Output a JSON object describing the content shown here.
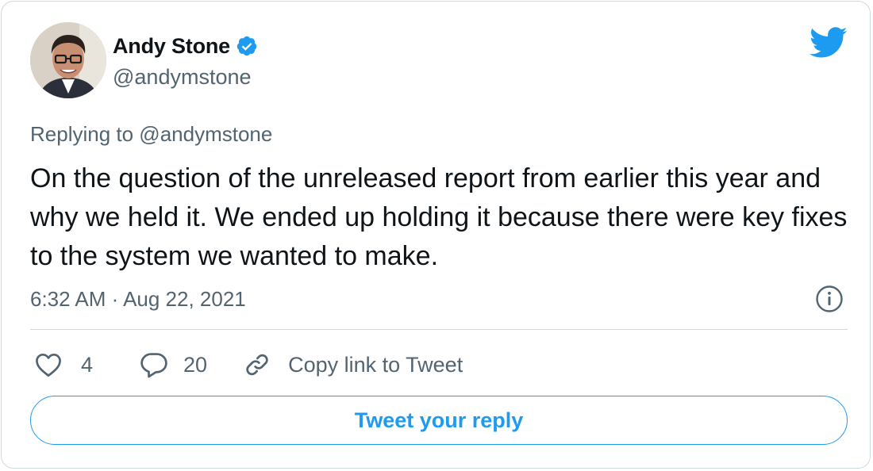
{
  "author": {
    "display_name": "Andy Stone",
    "handle": "@andymstone",
    "verified": true
  },
  "tweet": {
    "replying_to": "Replying to @andymstone",
    "text": "On the question of the unreleased report from earlier this year and why we held it. We ended up holding it because there were key fixes to the system we wanted to make.",
    "timestamp": "6:32 AM · Aug 22, 2021"
  },
  "actions": {
    "likes": "4",
    "replies": "20",
    "copy_link_label": "Copy link to Tweet"
  },
  "reply_button_label": "Tweet your reply",
  "icons": {
    "brand": "twitter-bird-icon",
    "verified": "verified-badge-icon",
    "info": "info-icon",
    "like": "heart-icon",
    "reply": "speech-bubble-icon",
    "copy": "link-icon"
  },
  "colors": {
    "accent": "#1d9bf0",
    "secondary_text": "#536471",
    "primary_text": "#0f1419",
    "border": "#cfd9de"
  }
}
